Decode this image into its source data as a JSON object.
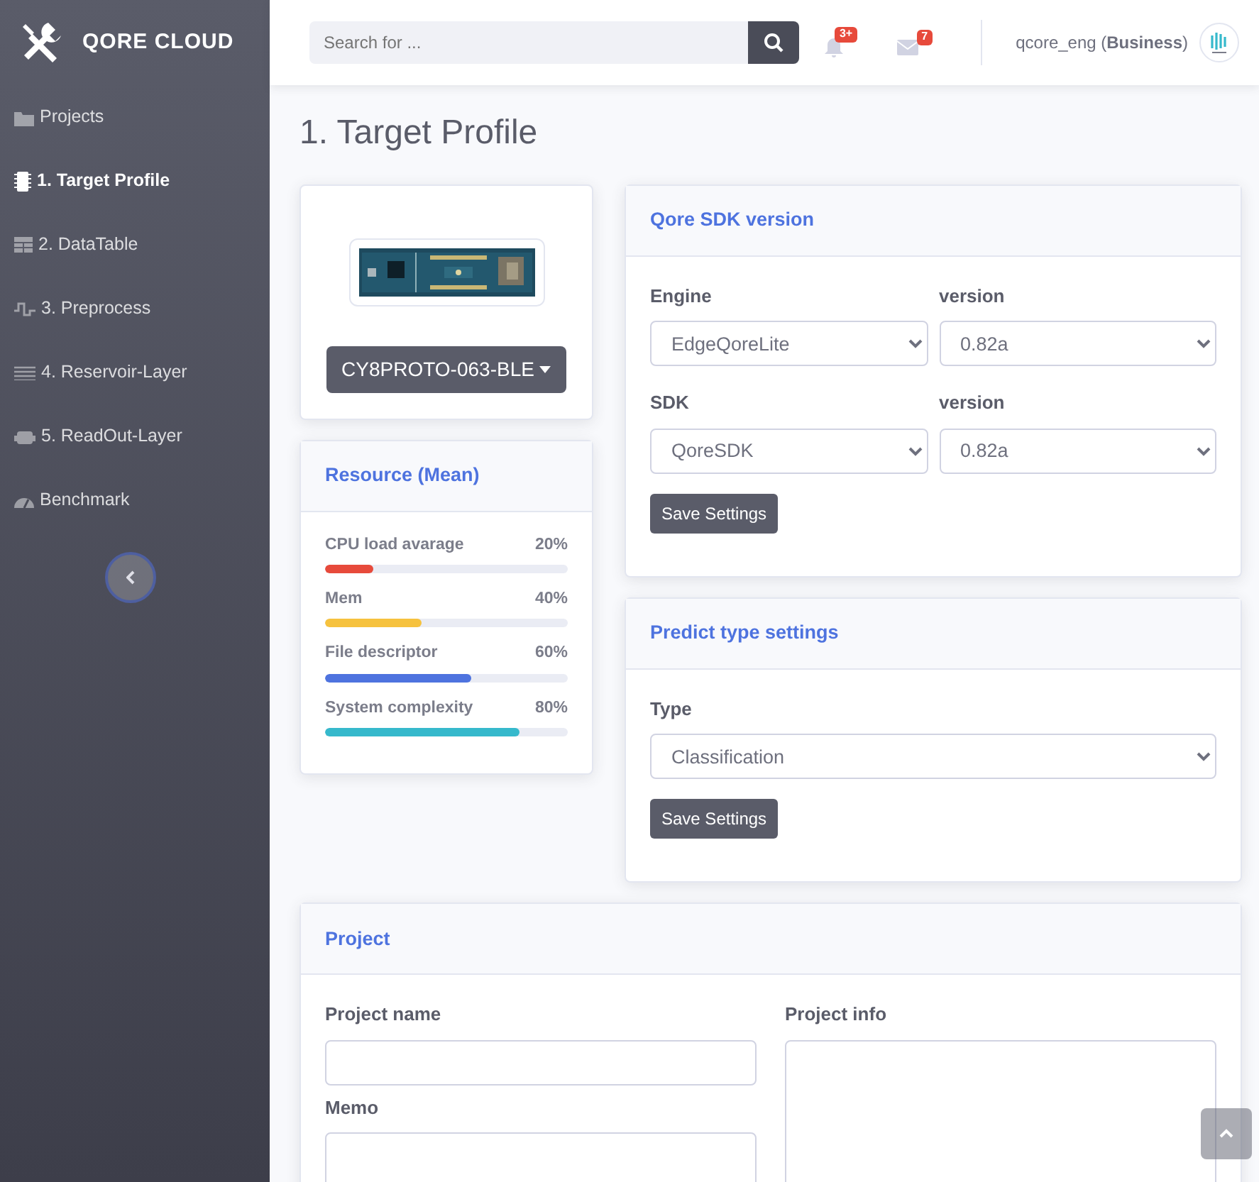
{
  "brand": "QORE CLOUD",
  "sidebar": {
    "items": [
      {
        "label": "Projects",
        "selected": false
      },
      {
        "label": "1. Target Profile",
        "selected": true
      },
      {
        "label": "2. DataTable",
        "selected": false
      },
      {
        "label": "3. Preprocess",
        "selected": false
      },
      {
        "label": "4. Reservoir-Layer",
        "selected": false
      },
      {
        "label": "5. ReadOut-Layer",
        "selected": false
      },
      {
        "label": "Benchmark",
        "selected": false
      }
    ]
  },
  "topbar": {
    "search": {
      "placeholder": "Search for ..."
    },
    "alerts_badge": "3+",
    "messages_badge": "7",
    "user": "qcore_eng (**Business**)"
  },
  "page_title": "1. Target Profile",
  "device": {
    "name": "CY8PROTO-063-BLE"
  },
  "resource": {
    "title": "Resource (Mean)",
    "meters": [
      {
        "label": "CPU load avarage",
        "reading": "20%",
        "level": 0.2,
        "color": "#e74a3b"
      },
      {
        "label": "Mem",
        "reading": "40%",
        "level": 0.4,
        "color": "#f6c23e"
      },
      {
        "label": "File descriptor",
        "reading": "60%",
        "level": 0.6,
        "color": "#4e73df"
      },
      {
        "label": "System complexity",
        "reading": "80%",
        "level": 0.8,
        "color": "#36b9cc"
      }
    ]
  },
  "sdk": {
    "title": "Qore SDK version",
    "rows": [
      {
        "label": "Engine",
        "value": "EdgeQoreLite",
        "version_label": "version",
        "version": "0.82a"
      },
      {
        "label": "SDK",
        "value": "QoreSDK",
        "version_label": "version",
        "version": "0.82a"
      }
    ],
    "button": "Save Settings"
  },
  "predict": {
    "title": "Predict type settings",
    "label": "Type",
    "value": "Classification",
    "button": "Save Settings"
  },
  "project": {
    "title": "Project",
    "name_label": "Project name",
    "info_label": "Project info",
    "memo_label": "Memo"
  }
}
